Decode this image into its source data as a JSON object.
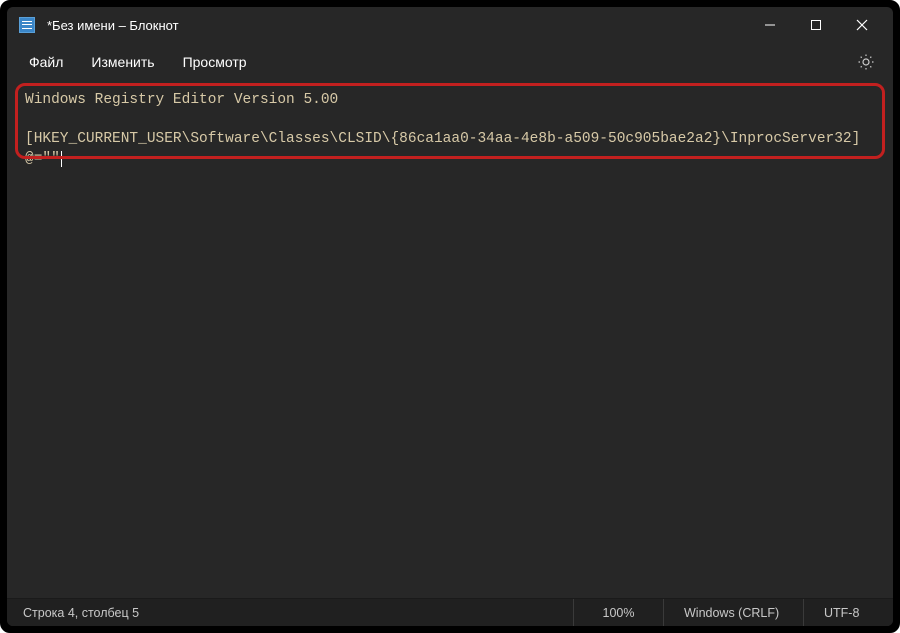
{
  "titlebar": {
    "title": "*Без имени – Блокнот"
  },
  "menu": {
    "file": "Файл",
    "edit": "Изменить",
    "view": "Просмотр"
  },
  "editor": {
    "line1": "Windows Registry Editor Version 5.00",
    "line2": "",
    "line3": "[HKEY_CURRENT_USER\\Software\\Classes\\CLSID\\{86ca1aa0-34aa-4e8b-a509-50c905bae2a2}\\InprocServer32]",
    "line4": "@=\"\""
  },
  "statusbar": {
    "position": "Строка 4, столбец 5",
    "zoom": "100%",
    "eol": "Windows (CRLF)",
    "encoding": "UTF-8"
  }
}
